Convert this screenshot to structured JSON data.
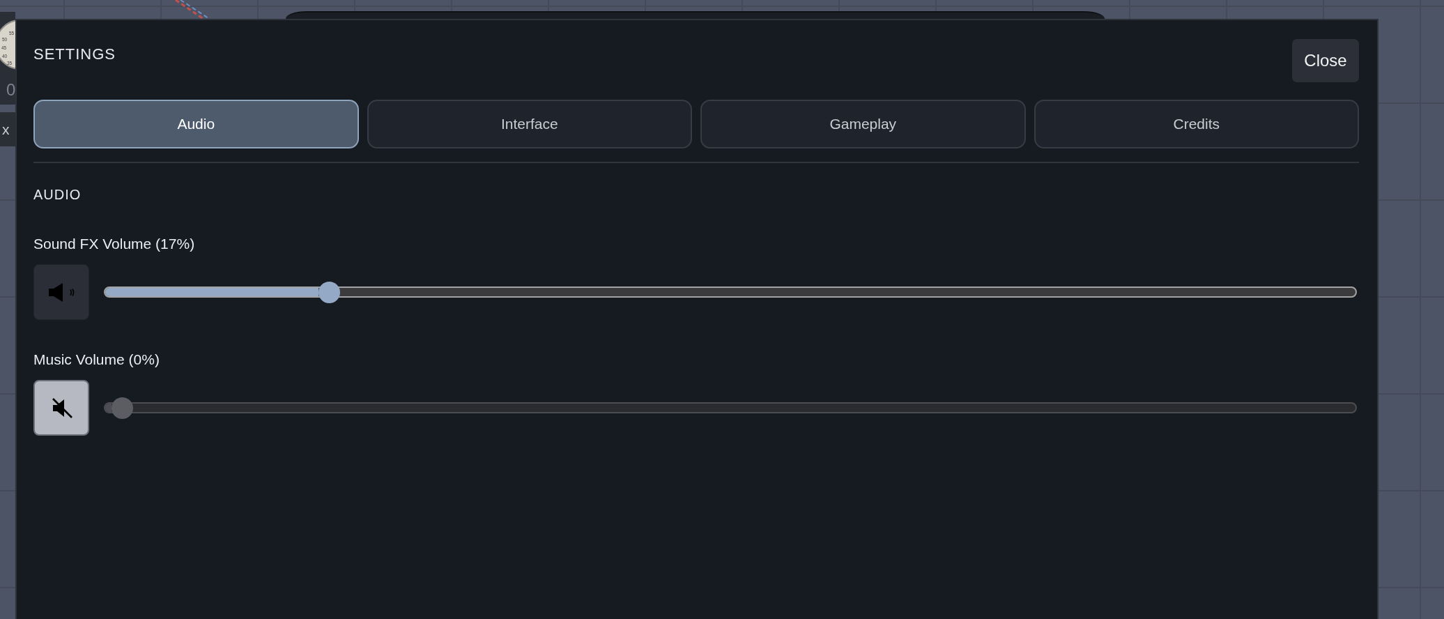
{
  "hud": {
    "dial_labels": [
      "55",
      "50",
      "45",
      "40",
      "35"
    ],
    "timer": "0",
    "chip": "x"
  },
  "window": {
    "title": "SETTINGS",
    "close_label": "Close"
  },
  "tabs": [
    {
      "label": "Audio",
      "selected": true
    },
    {
      "label": "Interface",
      "selected": false
    },
    {
      "label": "Gameplay",
      "selected": false
    },
    {
      "label": "Credits",
      "selected": false
    }
  ],
  "section": {
    "title": "AUDIO"
  },
  "controls": [
    {
      "label": "Sound FX Volume (17%)",
      "muted": false,
      "level": 0.17
    },
    {
      "label": "Music Volume (0%)",
      "muted": true,
      "level": 0
    }
  ]
}
